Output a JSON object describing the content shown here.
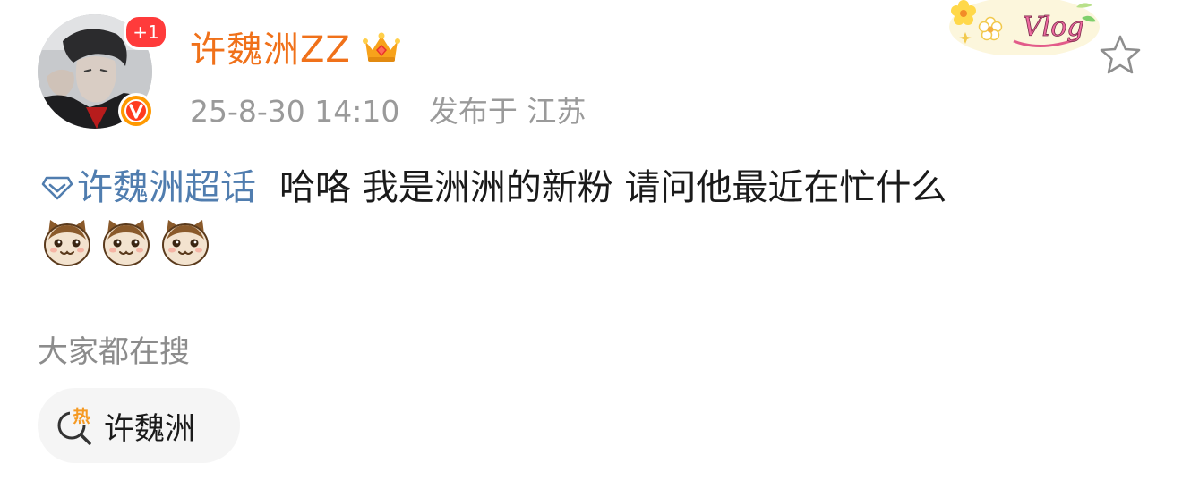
{
  "header": {
    "avatar_badge": "+1",
    "username": "许魏洲ZZ",
    "timestamp": "25-8-30 14:10",
    "location": "发布于 江苏",
    "sticker_text": "Vlog"
  },
  "post": {
    "topic_label": "许魏洲超话",
    "text": "哈咯 我是洲洲的新粉 请问他最近在忙什么"
  },
  "search": {
    "heading": "大家都在搜",
    "hot_label": "热",
    "chip_label": "许魏洲"
  },
  "icons": {
    "username_badge": "crown-icon",
    "verified": "verified-v-icon",
    "favorite": "star-icon",
    "topic": "diamond-topic-icon",
    "emoji": "cat-emoji",
    "hot_search": "hot-search-icon"
  },
  "colors": {
    "username": "#f0711a",
    "topic_link": "#507daf",
    "meta_text": "#9a9a9a",
    "badge_red": "#ff3b3b",
    "verified_orange": "#ff9900",
    "chip_bg": "#f5f5f5"
  }
}
